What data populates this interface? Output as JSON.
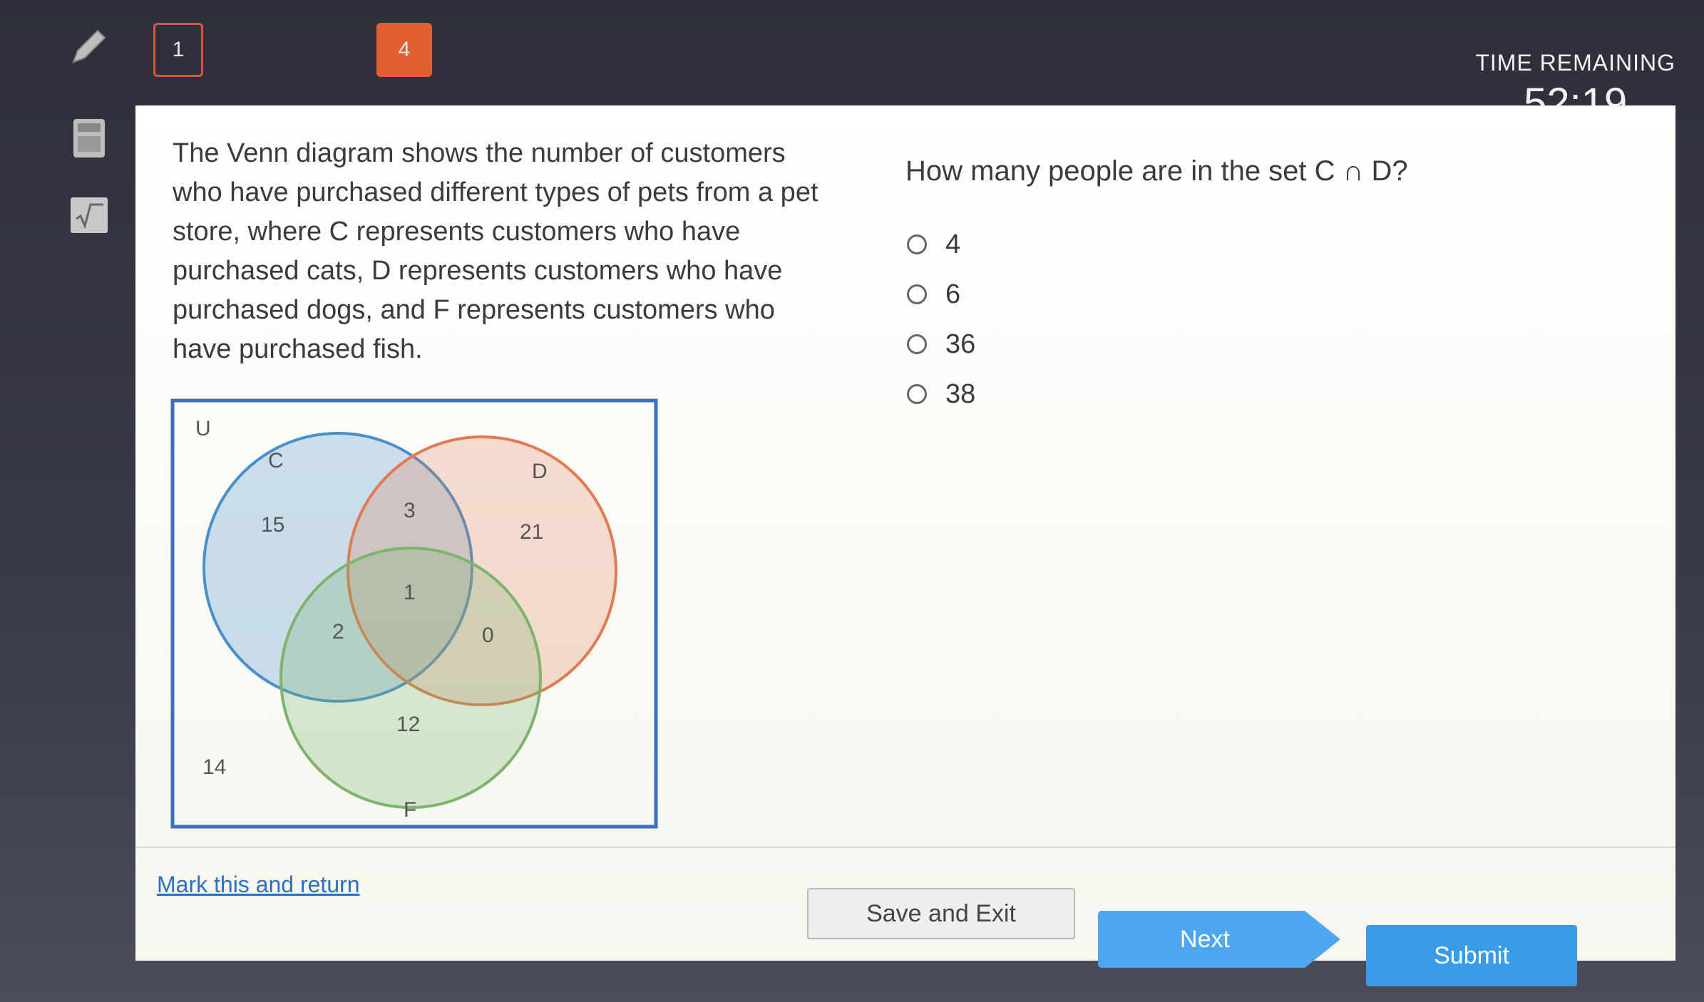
{
  "nav": {
    "question_tabs": [
      "1",
      "4"
    ]
  },
  "timer": {
    "label": "TIME REMAINING",
    "value": "52:19"
  },
  "prompt": {
    "text": "The Venn diagram shows the number of customers who have purchased different types of pets from a pet store, where C represents customers who have purchased cats, D represents customers who have purchased dogs, and F represents customers who have purchased fish."
  },
  "venn": {
    "universe_label": "U",
    "set_labels": {
      "c": "C",
      "d": "D",
      "f": "F"
    },
    "regions": {
      "c_only": "15",
      "d_only": "21",
      "c_and_d_only": "3",
      "c_d_f": "1",
      "c_and_f_only": "2",
      "d_and_f_only": "0",
      "f_only": "12",
      "outside": "14"
    },
    "colors": {
      "c": "#4a90c8",
      "d": "#e07a52",
      "f": "#7bb46a",
      "border": "#3a6fc4"
    }
  },
  "question": {
    "text": "How many people are in the set C ∩ D?",
    "options": [
      "4",
      "6",
      "36",
      "38"
    ]
  },
  "footer": {
    "mark_link": "Mark this and return",
    "save_label": "Save and Exit",
    "next_label": "Next",
    "submit_label": "Submit"
  }
}
